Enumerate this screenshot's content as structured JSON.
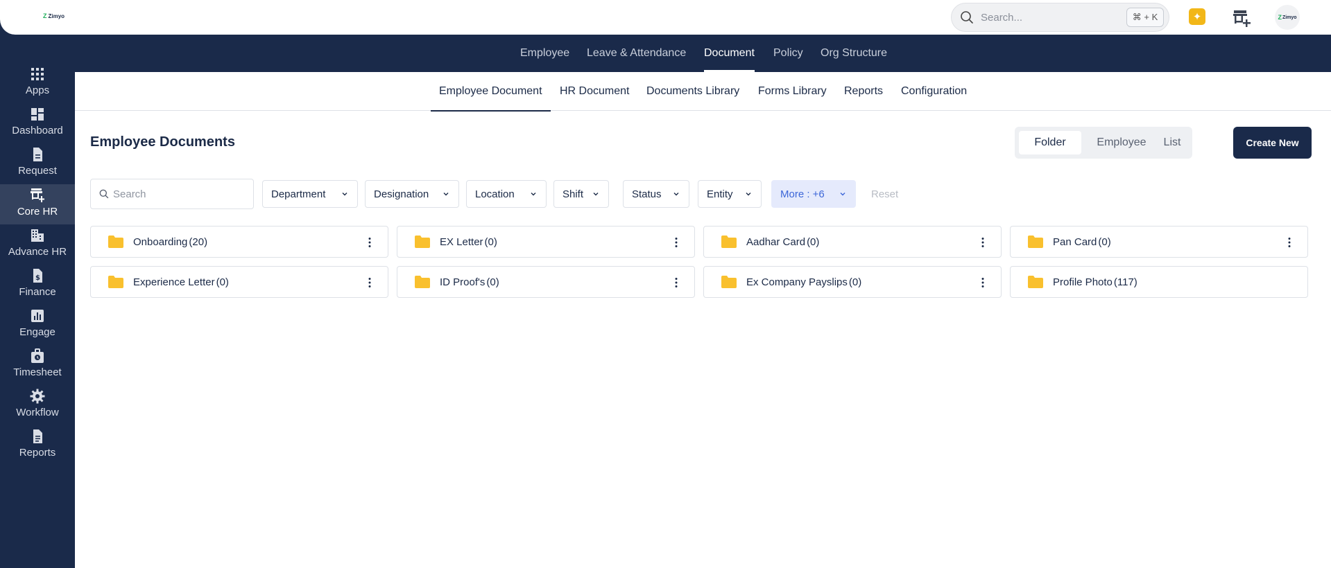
{
  "header": {
    "logo_text": "Zimyo",
    "search_placeholder": "Search...",
    "search_shortcut": "⌘ + K",
    "avatar_text": "Zimyo"
  },
  "sidebar": {
    "items": [
      {
        "label": "Apps",
        "icon": "grid-icon"
      },
      {
        "label": "Dashboard",
        "icon": "dashboard-icon"
      },
      {
        "label": "Request",
        "icon": "document-icon"
      },
      {
        "label": "Core HR",
        "icon": "store-add-icon",
        "active": true
      },
      {
        "label": "Advance HR",
        "icon": "building-icon"
      },
      {
        "label": "Finance",
        "icon": "finance-doc-icon"
      },
      {
        "label": "Engage",
        "icon": "bar-chart-icon"
      },
      {
        "label": "Timesheet",
        "icon": "clock-bag-icon"
      },
      {
        "label": "Workflow",
        "icon": "gear-icon"
      },
      {
        "label": "Reports",
        "icon": "report-icon"
      }
    ]
  },
  "module_nav": {
    "tabs": [
      "Employee",
      "Leave & Attendance",
      "Document",
      "Policy",
      "Org Structure"
    ],
    "active": "Document"
  },
  "sub_nav": {
    "tabs": [
      "Employee Document",
      "HR Document",
      "Documents Library",
      "Forms Library",
      "Reports",
      "Configuration"
    ],
    "active": "Employee Document"
  },
  "page": {
    "title": "Employee Documents",
    "view_options": [
      "Folder",
      "Employee",
      "List"
    ],
    "active_view": "Folder",
    "create_label": "Create New"
  },
  "filters": {
    "search_placeholder": "Search",
    "items": [
      "Department",
      "Designation",
      "Location",
      "Shift",
      "Status",
      "Entity"
    ],
    "more_label": "More : +6",
    "reset_label": "Reset"
  },
  "folders": [
    {
      "name": "Onboarding",
      "count": "(20)"
    },
    {
      "name": "EX Letter",
      "count": "(0)"
    },
    {
      "name": "Aadhar Card",
      "count": "(0)"
    },
    {
      "name": "Pan Card",
      "count": "(0)"
    },
    {
      "name": "Experience Letter",
      "count": "(0)"
    },
    {
      "name": "ID Proof's",
      "count": "(0)"
    },
    {
      "name": "Ex Company Payslips",
      "count": "(0)"
    },
    {
      "name": "Profile Photo",
      "count": "(117)"
    }
  ],
  "colors": {
    "navy": "#1a2a4a",
    "folder_yellow": "#f9c02e",
    "accent_blue": "#3c66d8",
    "spark_yellow": "#f2b718"
  }
}
